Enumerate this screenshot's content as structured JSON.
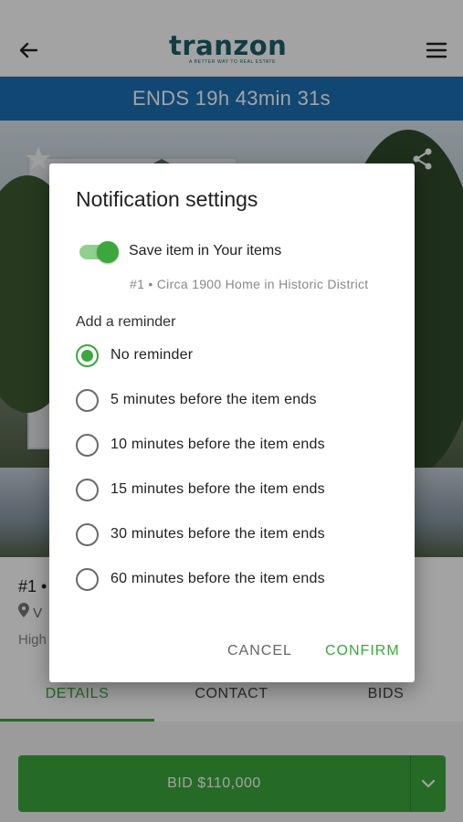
{
  "app": {
    "logo_text": "tranzon",
    "logo_tagline": "A BETTER WAY TO REAL ESTATE"
  },
  "countdown": "ENDS 19h 43min 31s",
  "listing": {
    "lot": "#1 •",
    "location": "V",
    "high_bid": "High"
  },
  "tabs": [
    {
      "label": "DETAILS",
      "active": true
    },
    {
      "label": "CONTACT",
      "active": false
    },
    {
      "label": "BIDS",
      "active": false
    }
  ],
  "bid_button": "BID $110,000",
  "dialog": {
    "title": "Notification settings",
    "save_toggle_label": "Save item in Your items",
    "save_toggle_on": true,
    "item_subtitle": "#1 • Circa 1900 Home in Historic District",
    "reminder_heading": "Add a reminder",
    "options": [
      {
        "label": "No reminder",
        "selected": true
      },
      {
        "label": "5 minutes before the item ends",
        "selected": false
      },
      {
        "label": "10 minutes before the item ends",
        "selected": false
      },
      {
        "label": "15 minutes before the item ends",
        "selected": false
      },
      {
        "label": "30 minutes before the item ends",
        "selected": false
      },
      {
        "label": "60 minutes before the item ends",
        "selected": false
      }
    ],
    "cancel_label": "CANCEL",
    "confirm_label": "CONFIRM"
  },
  "colors": {
    "accent_green": "#3aa83a",
    "countdown_blue": "#1b6fb4",
    "logo_teal": "#1d5f6b"
  },
  "icons": [
    "back-arrow-icon",
    "hamburger-menu-icon",
    "star-icon",
    "share-icon",
    "location-pin-icon",
    "chevron-down-icon"
  ]
}
